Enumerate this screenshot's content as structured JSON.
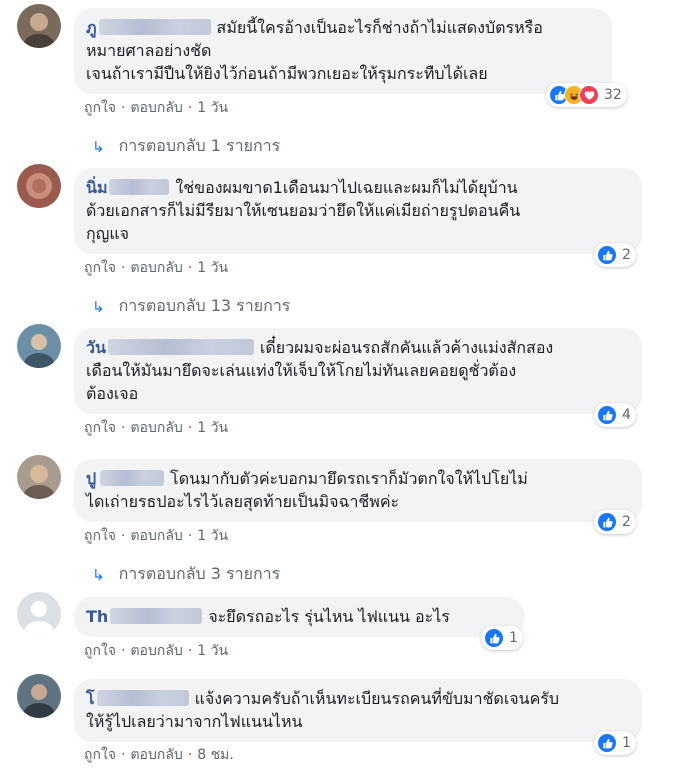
{
  "comments": [
    {
      "author_visible": "ภู",
      "text_lines": [
        "สมัยนี้ใครอ้างเป็นอะไรก็ช่างถ้าไม่แสดงบัตรหรือ",
        "หมายศาลอย่างชัด",
        "เจนถ้าเรามีปืนให้ยิงไว้ก่อนถ้ามีพวกเยอะให้รุมกระทืบได้เลย"
      ],
      "reactions": [
        "like",
        "haha",
        "love"
      ],
      "reaction_count": "32",
      "like_label": "ถูกใจ",
      "reply_label": "ตอบกลับ",
      "time": "1 วัน",
      "replies_label": "การตอบกลับ 1 รายการ"
    },
    {
      "author_visible": "นิ่ม",
      "text_lines": [
        "ใช่ของผมขาด1เดือนมาไปเฉยและผมก็ไม่ได้ยุบ้าน",
        "ด้วยเอกสารก็ไม่มีรียมาให้เซนยอมว่ายึดให้แค่เมียถ่ายรูปตอนคืน",
        "กุญแจ"
      ],
      "reactions": [
        "like"
      ],
      "reaction_count": "2",
      "like_label": "ถูกใจ",
      "reply_label": "ตอบกลับ",
      "time": "1 วัน",
      "replies_label": "การตอบกลับ 13 รายการ"
    },
    {
      "author_visible": "วัน",
      "text_lines": [
        "เดี๋ยวผมจะผ่อนรถสักคันแล้วค้างแม่งสักสอง",
        "เดือนให้มันมายึดจะเล่นแท่งให้เจ็บให้โกยไม่ทันเลยคอยดูชั่วต้อง",
        "ต้องเจอ"
      ],
      "reactions": [
        "like"
      ],
      "reaction_count": "4",
      "like_label": "ถูกใจ",
      "reply_label": "ตอบกลับ",
      "time": "1 วัน"
    },
    {
      "author_visible": "ปู",
      "text_lines": [
        "โดนมากับตัวค่ะบอกมายึดรถเราก็มัวตกใจให้ไปโยไม่",
        "ไดเถ่ายรธปอะไรไว้เลยสุดท้ายเป็นมิจฉาชีพค่ะ"
      ],
      "reactions": [
        "like"
      ],
      "reaction_count": "2",
      "like_label": "ถูกใจ",
      "reply_label": "ตอบกลับ",
      "time": "1 วัน",
      "replies_label": "การตอบกลับ 3 รายการ"
    },
    {
      "author_visible": "Th",
      "text_lines": [
        "จะยึดรถอะไร รุ่นไหน ไฟแนน อะไร"
      ],
      "reactions": [
        "like"
      ],
      "reaction_count": "1",
      "like_label": "ถูกใจ",
      "reply_label": "ตอบกลับ",
      "time": "1 วัน"
    },
    {
      "author_visible": "โ",
      "text_lines": [
        "แจ้งความครับถ้าเห็นทะเบียนรถคนที่ขับมาชัดเจนครับ",
        "ให้รู้ไปเลยว่ามาจากไฟแนนไหน"
      ],
      "reactions": [
        "like"
      ],
      "reaction_count": "1",
      "like_label": "ถูกใจ",
      "reply_label": "ตอบกลับ",
      "time": "8 ชม."
    }
  ],
  "separator": "·",
  "colors": {
    "author": "#385898",
    "bubble": "#f2f3f5",
    "meta": "#606770",
    "like": "#1877f2"
  }
}
